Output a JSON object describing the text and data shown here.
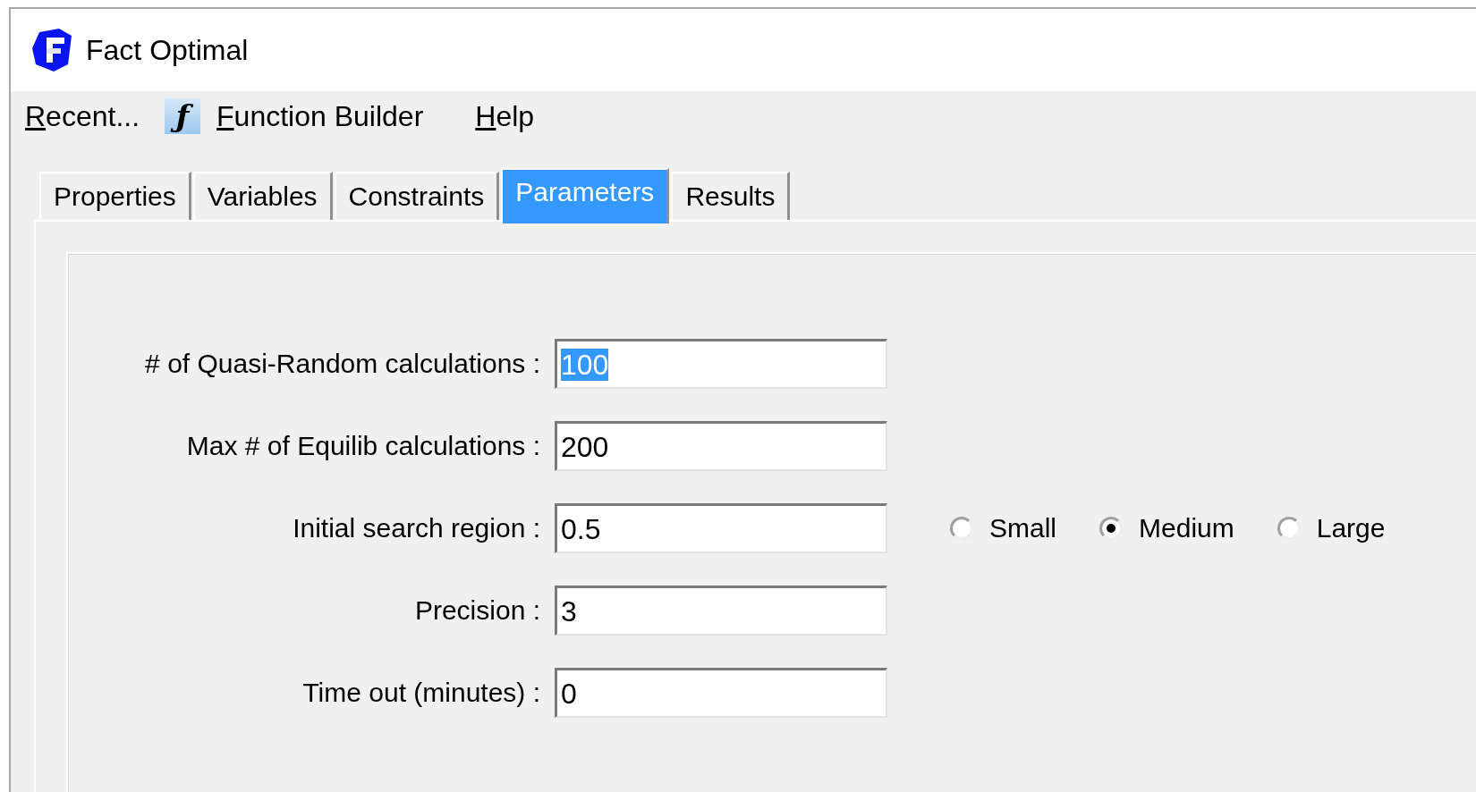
{
  "window": {
    "title": "Fact Optimal"
  },
  "menu": [
    {
      "label": "Recent...",
      "underline_first": true
    },
    {
      "label": "Function Builder",
      "underline_first": true,
      "icon_glyph": "ƒ"
    },
    {
      "label": "Help",
      "underline_first": true
    }
  ],
  "tabs": [
    {
      "label": "Properties",
      "selected": false
    },
    {
      "label": "Variables",
      "selected": false
    },
    {
      "label": "Constraints",
      "selected": false
    },
    {
      "label": "Parameters",
      "selected": true
    },
    {
      "label": "Results",
      "selected": false
    }
  ],
  "fields": [
    {
      "label": "# of Quasi-Random calculations :",
      "value": "100",
      "text_selected": true
    },
    {
      "label": "Max # of Equilib calculations :",
      "value": "200",
      "text_selected": false
    },
    {
      "label": "Initial search region :",
      "value": "0.5",
      "text_selected": false,
      "options": [
        {
          "label": "Small",
          "selected": false
        },
        {
          "label": "Medium",
          "selected": true
        },
        {
          "label": "Large",
          "selected": false
        }
      ]
    },
    {
      "label": "Precision :",
      "value": "3",
      "text_selected": false
    },
    {
      "label": "Time out (minutes) :",
      "value": "0",
      "text_selected": false
    }
  ]
}
